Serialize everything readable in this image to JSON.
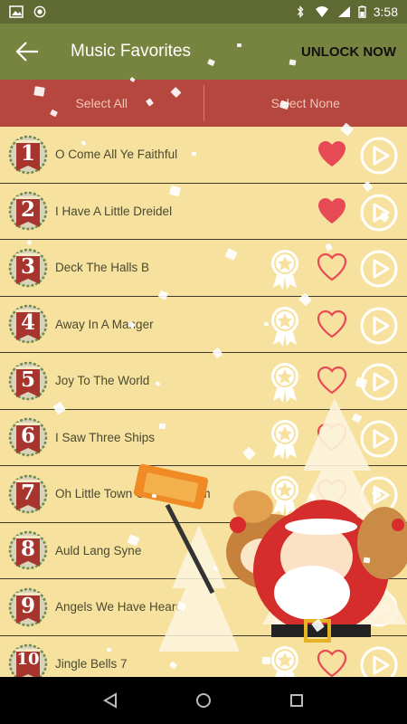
{
  "status": {
    "time": "3:58"
  },
  "app_bar": {
    "title": "Music Favorites",
    "unlock_label": "UNLOCK NOW"
  },
  "select_bar": {
    "select_all": "Select All",
    "select_none": "Select None"
  },
  "songs": [
    {
      "number": "1",
      "title": "O Come All Ye Faithful",
      "favorite": true,
      "locked": false
    },
    {
      "number": "2",
      "title": "I Have A Little Dreidel",
      "favorite": true,
      "locked": false
    },
    {
      "number": "3",
      "title": "Deck The Halls B",
      "favorite": false,
      "locked": true
    },
    {
      "number": "4",
      "title": "Away In A Manger",
      "favorite": false,
      "locked": true
    },
    {
      "number": "5",
      "title": "Joy To The World",
      "favorite": false,
      "locked": true
    },
    {
      "number": "6",
      "title": "I Saw Three Ships",
      "favorite": false,
      "locked": true
    },
    {
      "number": "7",
      "title": "Oh Little Town Of Bethlehem",
      "favorite": false,
      "locked": true
    },
    {
      "number": "8",
      "title": "Auld Lang Syne",
      "favorite": false,
      "locked": true
    },
    {
      "number": "9",
      "title": "Angels We Have Heard",
      "favorite": false,
      "locked": true
    },
    {
      "number": "10",
      "title": "Jingle Bells 7",
      "favorite": false,
      "locked": true
    }
  ],
  "icons": {
    "back": "arrow-back-icon",
    "heart_filled": "heart-filled-icon",
    "heart_outline": "heart-outline-icon",
    "play": "play-icon",
    "achievement": "star-medal-icon"
  },
  "colors": {
    "app_bar": "#77843f",
    "status_bar": "#5f6a33",
    "select_bar": "#b5473f",
    "list_bg": "#f6e19e",
    "heart": "#e84a55",
    "badge": "#a8342e"
  }
}
